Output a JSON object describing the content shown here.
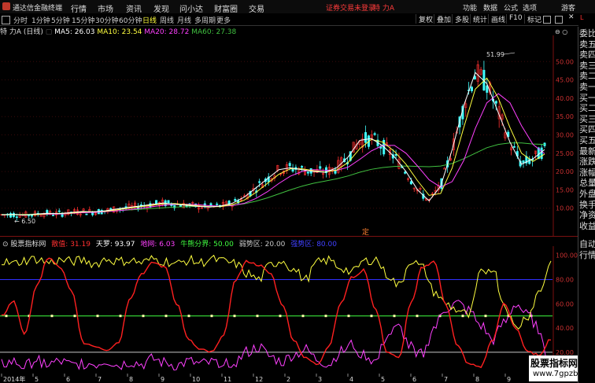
{
  "app": {
    "name": "通达信金融终端"
  },
  "menu": [
    "行情",
    "市场",
    "资讯",
    "发现",
    "问小达",
    "财富圈",
    "交易"
  ],
  "notice": "证券交易未登录",
  "stock_name_header": "特 力A",
  "top_right": [
    "功能",
    "数据",
    "公式",
    "选项",
    "游客"
  ],
  "period_tabs": [
    "分时",
    "1分钟",
    "5分钟",
    "15分钟",
    "30分钟",
    "60分钟",
    "日线",
    "周线",
    "月线",
    "多周期",
    "更多"
  ],
  "active_tab": "日线",
  "toolbar_right": [
    "复权",
    "叠加",
    "多股",
    "统计",
    "画线",
    "F10",
    "标记"
  ],
  "ma": {
    "stock": "特 力A (日线)",
    "ma5": "MA5: 26.03",
    "ma10": "MA10: 23.54",
    "ma20": "MA20: 28.72",
    "ma60": "MA60: 27.38"
  },
  "colors": {
    "ma5": "#ffffff",
    "ma10": "#ffff40",
    "ma20": "#ff40ff",
    "ma60": "#40c040",
    "up": "#ff3030",
    "down": "#40ffff"
  },
  "price_annotations": {
    "high": "51.99",
    "low": "6.50",
    "mark": "定"
  },
  "indicator": {
    "name": "股票指标网",
    "items": [
      {
        "label": "散值: 31.19",
        "color": "#ff3030"
      },
      {
        "label": "天罗: 93.97",
        "color": "#ffffff"
      },
      {
        "label": "地网: 6.03",
        "color": "#ff40ff"
      },
      {
        "label": "牛熊分界: 50.00",
        "color": "#40ff40"
      },
      {
        "label": "弱势区: 20.00",
        "color": "#c8c8c8"
      },
      {
        "label": "强势区: 80.00",
        "color": "#4040ff"
      }
    ]
  },
  "right_panel": [
    "委比",
    "卖五",
    "卖四",
    "卖三",
    "卖二",
    "卖一",
    "买一",
    "买二",
    "买三",
    "买四",
    "买五",
    "最新",
    "涨跌",
    "涨幅",
    "总量",
    "外盘",
    "换手",
    "净资",
    "收益"
  ],
  "right_panel_bottom": [
    "自动",
    "行情"
  ],
  "watermark": {
    "line1": "股票指标网",
    "line2": "www.7gpzb.com"
  },
  "chart_data": [
    {
      "type": "line",
      "title": "",
      "y_ticks": [
        10.0,
        15.0,
        20.0,
        25.0,
        30.0,
        35.0,
        40.0,
        45.0,
        50.0
      ],
      "ylim": [
        5,
        55
      ],
      "x_ticks": [
        "2014年",
        "5",
        "6",
        "7",
        "8",
        "9",
        "10",
        "11",
        "12",
        "2",
        "3",
        "4",
        "5",
        "6",
        "7",
        "8",
        "9"
      ],
      "series": [
        {
          "name": "MA5",
          "values": [
            8.2,
            8.3,
            8.1,
            8.4,
            8.6,
            8.5,
            8.8,
            9.1,
            9.0,
            9.3,
            9.8,
            10.2,
            10.6,
            11.0,
            11.4,
            11.1,
            10.8,
            10.5,
            10.3,
            10.6,
            11.4,
            13.0,
            15.5,
            18.0,
            20.5,
            21.0,
            20.5,
            20.0,
            19.8,
            21.0,
            24.0,
            28.5,
            29.0,
            27.0,
            24.0,
            20.0,
            15.0,
            12.0,
            16.0,
            26.0,
            38.0,
            47.0,
            44.0,
            36.0,
            28.0,
            22.0,
            23.5,
            26.0
          ]
        },
        {
          "name": "MA60",
          "values": [
            8.3,
            8.3,
            8.3,
            8.4,
            8.5,
            8.6,
            8.7,
            8.8,
            8.9,
            9.1,
            9.3,
            9.5,
            9.7,
            9.9,
            10.1,
            10.3,
            10.4,
            10.5,
            10.5,
            10.6,
            10.8,
            11.2,
            11.9,
            12.8,
            13.9,
            15.0,
            16.0,
            16.8,
            17.4,
            18.0,
            18.8,
            19.8,
            20.6,
            21.1,
            21.4,
            21.5,
            21.4,
            21.3,
            21.5,
            22.2,
            23.5,
            25.0,
            26.5,
            27.4,
            27.8,
            27.8,
            27.5,
            27.4
          ]
        }
      ]
    },
    {
      "type": "line",
      "title": "",
      "y_ticks": [
        20.0,
        40.0,
        60.0,
        80.0,
        100.0
      ],
      "ylim": [
        5,
        105
      ],
      "levels": [
        20,
        50,
        80
      ],
      "series": [
        {
          "name": "散值",
          "values": [
            50,
            62,
            35,
            75,
            98,
            90,
            70,
            28,
            25,
            22,
            28,
            65,
            85,
            94,
            90,
            60,
            30,
            22,
            20,
            35,
            80,
            95,
            92,
            85,
            60,
            30,
            15,
            10,
            25,
            60,
            82,
            88,
            55,
            20,
            15,
            60,
            90,
            95,
            60,
            25,
            10,
            8,
            30,
            60,
            40,
            20,
            18,
            31
          ]
        },
        {
          "name": "天罗",
          "values": [
            95,
            93,
            96,
            97,
            94,
            96,
            95,
            96,
            93,
            97,
            95,
            96,
            94,
            97,
            95,
            93,
            96,
            94,
            97,
            95,
            93,
            85,
            80,
            92,
            96,
            88,
            80,
            94,
            96,
            90,
            86,
            95,
            97,
            84,
            75,
            96,
            90,
            70,
            60,
            55,
            50,
            85,
            90,
            60,
            40,
            50,
            70,
            94
          ]
        },
        {
          "name": "地网",
          "values": [
            10,
            12,
            8,
            14,
            10,
            12,
            9,
            11,
            10,
            13,
            9,
            12,
            10,
            14,
            11,
            9,
            12,
            10,
            11,
            13,
            12,
            20,
            24,
            16,
            12,
            18,
            22,
            14,
            10,
            20,
            26,
            18,
            12,
            34,
            40,
            24,
            18,
            40,
            56,
            60,
            54,
            42,
            30,
            44,
            60,
            50,
            40,
            6
          ]
        }
      ]
    }
  ]
}
